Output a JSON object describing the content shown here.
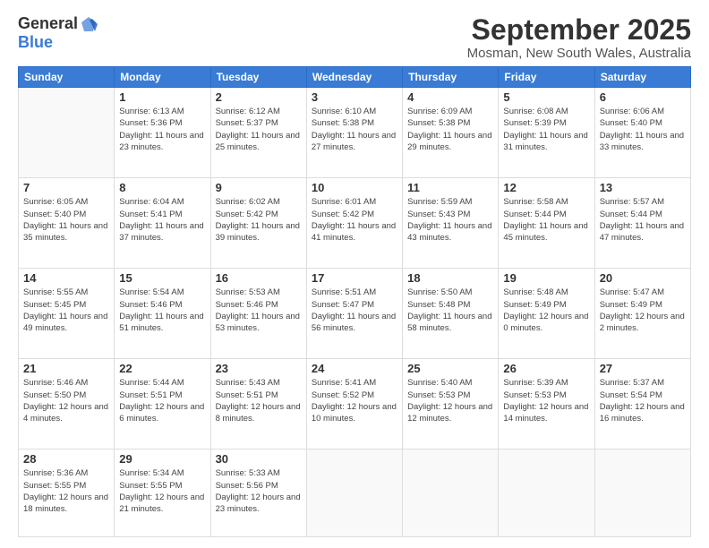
{
  "logo": {
    "general": "General",
    "blue": "Blue"
  },
  "title": "September 2025",
  "location": "Mosman, New South Wales, Australia",
  "days_header": [
    "Sunday",
    "Monday",
    "Tuesday",
    "Wednesday",
    "Thursday",
    "Friday",
    "Saturday"
  ],
  "weeks": [
    [
      {
        "day": "",
        "info": ""
      },
      {
        "day": "1",
        "info": "Sunrise: 6:13 AM\nSunset: 5:36 PM\nDaylight: 11 hours\nand 23 minutes."
      },
      {
        "day": "2",
        "info": "Sunrise: 6:12 AM\nSunset: 5:37 PM\nDaylight: 11 hours\nand 25 minutes."
      },
      {
        "day": "3",
        "info": "Sunrise: 6:10 AM\nSunset: 5:38 PM\nDaylight: 11 hours\nand 27 minutes."
      },
      {
        "day": "4",
        "info": "Sunrise: 6:09 AM\nSunset: 5:38 PM\nDaylight: 11 hours\nand 29 minutes."
      },
      {
        "day": "5",
        "info": "Sunrise: 6:08 AM\nSunset: 5:39 PM\nDaylight: 11 hours\nand 31 minutes."
      },
      {
        "day": "6",
        "info": "Sunrise: 6:06 AM\nSunset: 5:40 PM\nDaylight: 11 hours\nand 33 minutes."
      }
    ],
    [
      {
        "day": "7",
        "info": "Sunrise: 6:05 AM\nSunset: 5:40 PM\nDaylight: 11 hours\nand 35 minutes."
      },
      {
        "day": "8",
        "info": "Sunrise: 6:04 AM\nSunset: 5:41 PM\nDaylight: 11 hours\nand 37 minutes."
      },
      {
        "day": "9",
        "info": "Sunrise: 6:02 AM\nSunset: 5:42 PM\nDaylight: 11 hours\nand 39 minutes."
      },
      {
        "day": "10",
        "info": "Sunrise: 6:01 AM\nSunset: 5:42 PM\nDaylight: 11 hours\nand 41 minutes."
      },
      {
        "day": "11",
        "info": "Sunrise: 5:59 AM\nSunset: 5:43 PM\nDaylight: 11 hours\nand 43 minutes."
      },
      {
        "day": "12",
        "info": "Sunrise: 5:58 AM\nSunset: 5:44 PM\nDaylight: 11 hours\nand 45 minutes."
      },
      {
        "day": "13",
        "info": "Sunrise: 5:57 AM\nSunset: 5:44 PM\nDaylight: 11 hours\nand 47 minutes."
      }
    ],
    [
      {
        "day": "14",
        "info": "Sunrise: 5:55 AM\nSunset: 5:45 PM\nDaylight: 11 hours\nand 49 minutes."
      },
      {
        "day": "15",
        "info": "Sunrise: 5:54 AM\nSunset: 5:46 PM\nDaylight: 11 hours\nand 51 minutes."
      },
      {
        "day": "16",
        "info": "Sunrise: 5:53 AM\nSunset: 5:46 PM\nDaylight: 11 hours\nand 53 minutes."
      },
      {
        "day": "17",
        "info": "Sunrise: 5:51 AM\nSunset: 5:47 PM\nDaylight: 11 hours\nand 56 minutes."
      },
      {
        "day": "18",
        "info": "Sunrise: 5:50 AM\nSunset: 5:48 PM\nDaylight: 11 hours\nand 58 minutes."
      },
      {
        "day": "19",
        "info": "Sunrise: 5:48 AM\nSunset: 5:49 PM\nDaylight: 12 hours\nand 0 minutes."
      },
      {
        "day": "20",
        "info": "Sunrise: 5:47 AM\nSunset: 5:49 PM\nDaylight: 12 hours\nand 2 minutes."
      }
    ],
    [
      {
        "day": "21",
        "info": "Sunrise: 5:46 AM\nSunset: 5:50 PM\nDaylight: 12 hours\nand 4 minutes."
      },
      {
        "day": "22",
        "info": "Sunrise: 5:44 AM\nSunset: 5:51 PM\nDaylight: 12 hours\nand 6 minutes."
      },
      {
        "day": "23",
        "info": "Sunrise: 5:43 AM\nSunset: 5:51 PM\nDaylight: 12 hours\nand 8 minutes."
      },
      {
        "day": "24",
        "info": "Sunrise: 5:41 AM\nSunset: 5:52 PM\nDaylight: 12 hours\nand 10 minutes."
      },
      {
        "day": "25",
        "info": "Sunrise: 5:40 AM\nSunset: 5:53 PM\nDaylight: 12 hours\nand 12 minutes."
      },
      {
        "day": "26",
        "info": "Sunrise: 5:39 AM\nSunset: 5:53 PM\nDaylight: 12 hours\nand 14 minutes."
      },
      {
        "day": "27",
        "info": "Sunrise: 5:37 AM\nSunset: 5:54 PM\nDaylight: 12 hours\nand 16 minutes."
      }
    ],
    [
      {
        "day": "28",
        "info": "Sunrise: 5:36 AM\nSunset: 5:55 PM\nDaylight: 12 hours\nand 18 minutes."
      },
      {
        "day": "29",
        "info": "Sunrise: 5:34 AM\nSunset: 5:55 PM\nDaylight: 12 hours\nand 21 minutes."
      },
      {
        "day": "30",
        "info": "Sunrise: 5:33 AM\nSunset: 5:56 PM\nDaylight: 12 hours\nand 23 minutes."
      },
      {
        "day": "",
        "info": ""
      },
      {
        "day": "",
        "info": ""
      },
      {
        "day": "",
        "info": ""
      },
      {
        "day": "",
        "info": ""
      }
    ]
  ]
}
